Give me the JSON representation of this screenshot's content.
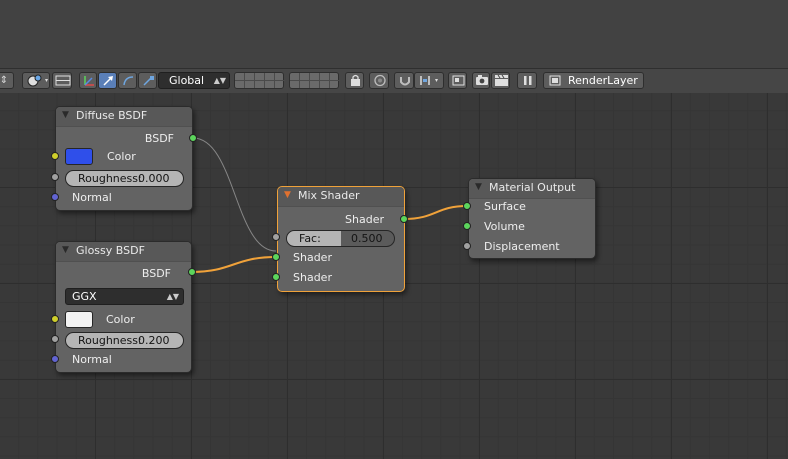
{
  "toolbar": {
    "orientation_label": "Global",
    "render_layer_label": "RenderLayer",
    "icons": [
      "orientation-arrows-icon",
      "snap-icon",
      "layers-icon",
      "camera-icon",
      "clapperboard-icon",
      "pause-icon",
      "render-layers-icon"
    ]
  },
  "nodes": {
    "diffuse": {
      "title": "Diffuse BSDF",
      "output": "BSDF",
      "color_label": "Color",
      "color_value": "#2f4fea",
      "roughness_label": "Roughness:",
      "roughness_value": "0.000",
      "normal_label": "Normal"
    },
    "glossy": {
      "title": "Glossy BSDF",
      "output": "BSDF",
      "distribution": "GGX",
      "color_label": "Color",
      "color_value": "#f2f2f2",
      "roughness_label": "Roughness:",
      "roughness_value": "0.200",
      "normal_label": "Normal"
    },
    "mix": {
      "title": "Mix Shader",
      "output": "Shader",
      "fac_label": "Fac:",
      "fac_value": "0.500",
      "fac_fraction": 0.5,
      "shader1": "Shader",
      "shader2": "Shader"
    },
    "output": {
      "title": "Material Output",
      "surface": "Surface",
      "volume": "Volume",
      "displacement": "Displacement"
    }
  },
  "colors": {
    "socket_shader": "#5cd55c",
    "socket_color": "#cfcf2b",
    "socket_value": "#a1a1a1",
    "socket_vector": "#6264d2",
    "selected_outline": "#f0a23a",
    "link_active": "#f0a23a",
    "link_inactive": "#c8c8c8"
  }
}
